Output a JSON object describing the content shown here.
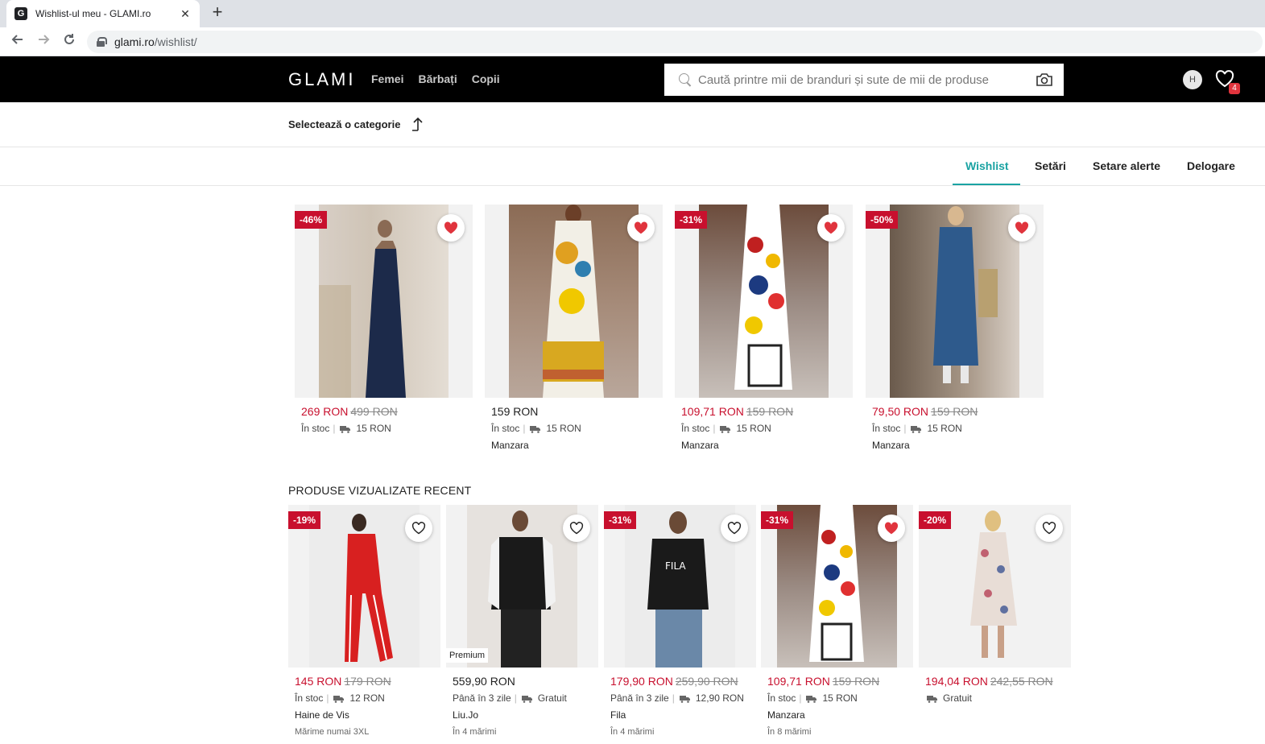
{
  "browser": {
    "tab_title": "Wishlist-ul meu - GLAMI.ro",
    "favicon": "G",
    "url_host": "glami.ro",
    "url_path": "/wishlist/"
  },
  "header": {
    "logo": "GLAMI",
    "nav": [
      "Femei",
      "Bărbați",
      "Copii"
    ],
    "search_placeholder": "Caută printre mii de branduri și sute de mii de produse",
    "avatar_initial": "H",
    "wishlist_count": "4"
  },
  "category_bar": {
    "label": "Selectează o categorie"
  },
  "account_tabs": [
    "Wishlist",
    "Setări",
    "Setare alerte",
    "Delogare"
  ],
  "wishlist": [
    {
      "badge": "-46%",
      "price": "269 RON",
      "old_price": "499 RON",
      "availability": "În stoc",
      "shipping": "15 RON",
      "brand": "",
      "liked": true,
      "photo": "navy-sequin-gown"
    },
    {
      "badge": "",
      "price": "159 RON",
      "old_price": "",
      "availability": "În stoc",
      "shipping": "15 RON",
      "brand": "Manzara",
      "liked": true,
      "photo": "floral-maxi-dress"
    },
    {
      "badge": "-31%",
      "price": "109,71 RON",
      "old_price": "159 RON",
      "availability": "În stoc",
      "shipping": "15 RON",
      "brand": "Manzara",
      "liked": true,
      "photo": "abstract-print-dress"
    },
    {
      "badge": "-50%",
      "price": "79,50 RON",
      "old_price": "159 RON",
      "availability": "În stoc",
      "shipping": "15 RON",
      "brand": "Manzara",
      "liked": true,
      "photo": "denim-shirt-dress"
    }
  ],
  "recent": {
    "title": "PRODUSE VIZUALIZATE RECENT",
    "items": [
      {
        "badge": "-19%",
        "price": "145 RON",
        "old_price": "179 RON",
        "availability": "În stoc",
        "shipping": "12 RON",
        "brand": "Haine de Vis",
        "sizes": "Mărime numai 3XL",
        "liked": false,
        "premium": ""
      },
      {
        "badge": "",
        "price": "559,90 RON",
        "old_price": "",
        "availability": "Până în 3 zile",
        "shipping": "Gratuit",
        "brand": "Liu.Jo",
        "sizes": "În 4 mărimi",
        "liked": false,
        "premium": "Premium"
      },
      {
        "badge": "-31%",
        "price": "179,90 RON",
        "old_price": "259,90 RON",
        "availability": "Până în 3 zile",
        "shipping": "12,90 RON",
        "brand": "Fila",
        "sizes": "În 4 mărimi",
        "liked": false,
        "premium": ""
      },
      {
        "badge": "-31%",
        "price": "109,71 RON",
        "old_price": "159 RON",
        "availability": "În stoc",
        "shipping": "15 RON",
        "brand": "Manzara",
        "sizes": "În 8 mărimi",
        "liked": true,
        "premium": ""
      },
      {
        "badge": "-20%",
        "price": "194,04 RON",
        "old_price": "242,55 RON",
        "availability": "",
        "shipping": "Gratuit",
        "brand": "",
        "sizes": "",
        "liked": false,
        "premium": ""
      }
    ]
  },
  "colors": {
    "accent": "#1aa3a3",
    "sale": "#c8102e",
    "heart": "#e0343d",
    "header_bg": "#000000"
  }
}
